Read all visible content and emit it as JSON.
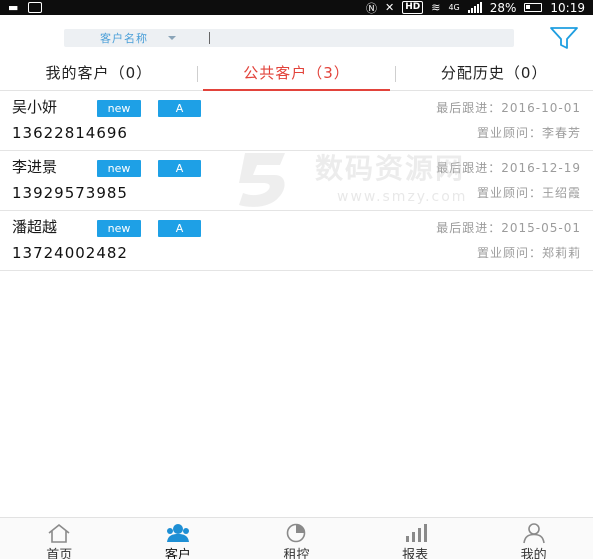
{
  "status_bar": {
    "network": "4G",
    "hd": "HD",
    "battery": "28%",
    "time": "10:19"
  },
  "search": {
    "type_label": "客户名称",
    "filter_icon": "filter-icon"
  },
  "tabs": [
    {
      "label": "我的客户",
      "count": "（0）"
    },
    {
      "label": "公共客户",
      "count": "（3）"
    },
    {
      "label": "分配历史",
      "count": "（0）"
    }
  ],
  "customers": [
    {
      "name": "吴小妍",
      "tag_new": "new",
      "level": "A",
      "phone": "13622814696",
      "last_follow": "最后跟进：2016-10-01",
      "advisor": "置业顾问：李春芳"
    },
    {
      "name": "李进景",
      "tag_new": "new",
      "level": "A",
      "phone": "13929573985",
      "last_follow": "最后跟进：2016-12-19",
      "advisor": "置业顾问：王绍霞"
    },
    {
      "name": "潘超越",
      "tag_new": "new",
      "level": "A",
      "phone": "13724002482",
      "last_follow": "最后跟进：2015-05-01",
      "advisor": "置业顾问：郑莉莉"
    }
  ],
  "watermark": {
    "text": "数码资源网",
    "url": "www.smzy.com"
  },
  "bottom_nav": [
    {
      "label": "首页",
      "icon": "home-icon"
    },
    {
      "label": "客户",
      "icon": "customers-icon"
    },
    {
      "label": "租控",
      "icon": "pie-chart-icon"
    },
    {
      "label": "报表",
      "icon": "bar-chart-icon"
    },
    {
      "label": "我的",
      "icon": "profile-icon"
    }
  ],
  "colors": {
    "accent_red": "#e2433b",
    "tag_blue": "#1ea0e6",
    "nav_active": "#1e8fd4"
  }
}
